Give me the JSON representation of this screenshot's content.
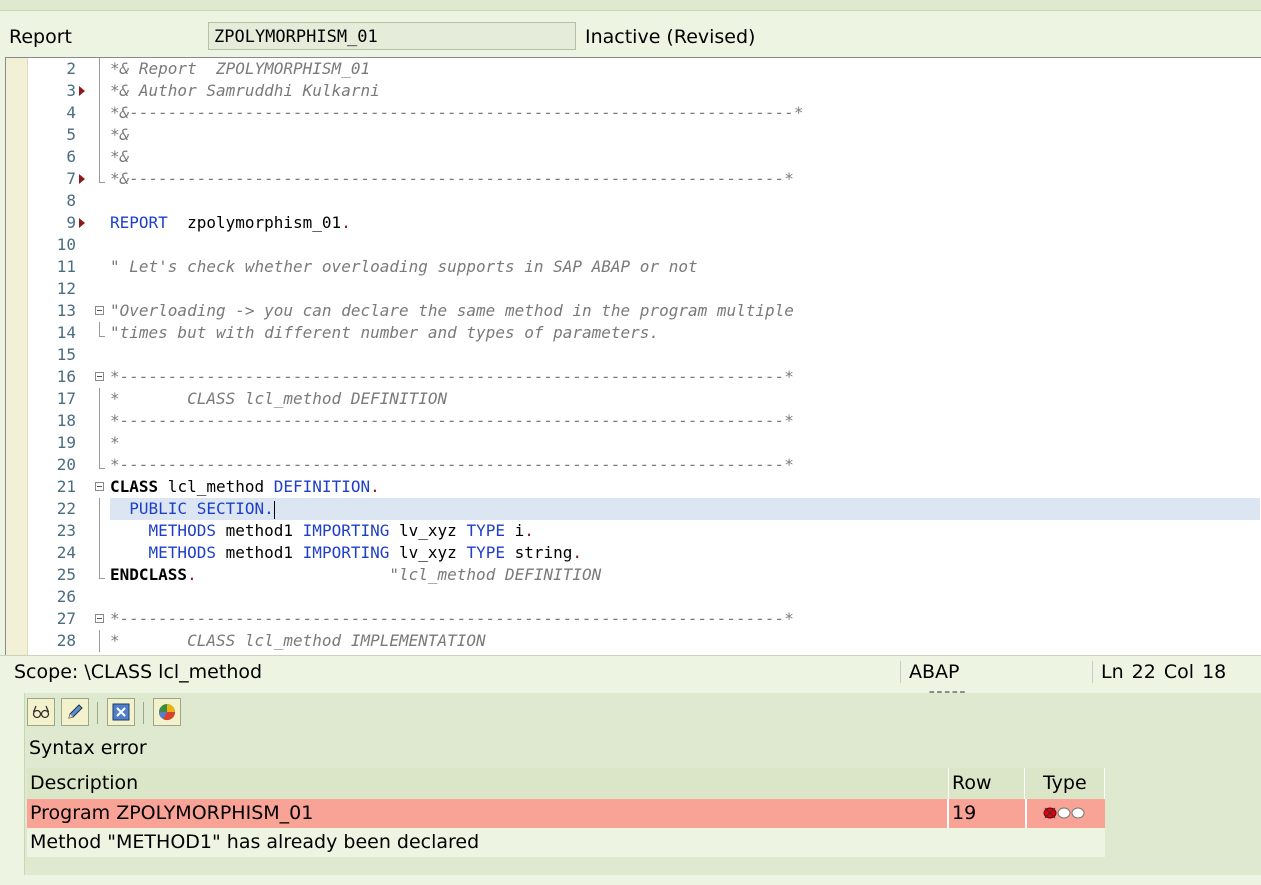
{
  "header": {
    "label": "Report",
    "program_name": "ZPOLYMORPHISM_01",
    "status": "Inactive (Revised)"
  },
  "editor": {
    "lines": [
      {
        "num": "2",
        "bp": false,
        "fold": "bar",
        "parts": [
          {
            "t": "*& Report  ZPOLYMORPHISM_01",
            "c": "cm"
          }
        ]
      },
      {
        "num": "3",
        "bp": true,
        "fold": "bar",
        "parts": [
          {
            "t": "*& Author Samruddhi Kulkarni",
            "c": "cm"
          }
        ]
      },
      {
        "num": "4",
        "bp": false,
        "fold": "bar",
        "parts": [
          {
            "t": "*&---------------------------------------------------------------------*",
            "c": "cm"
          }
        ]
      },
      {
        "num": "5",
        "bp": false,
        "fold": "bar",
        "parts": [
          {
            "t": "*&",
            "c": "cm"
          }
        ]
      },
      {
        "num": "6",
        "bp": false,
        "fold": "bar",
        "parts": [
          {
            "t": "*&",
            "c": "cm"
          }
        ]
      },
      {
        "num": "7",
        "bp": true,
        "fold": "end",
        "parts": [
          {
            "t": "*&--------------------------------------------------------------------*",
            "c": "cm"
          }
        ]
      },
      {
        "num": "8",
        "bp": false,
        "fold": "",
        "parts": []
      },
      {
        "num": "9",
        "bp": true,
        "fold": "",
        "parts": [
          {
            "t": "REPORT",
            "c": "kw"
          },
          {
            "t": "  zpolymorphism_01",
            "c": "tx"
          },
          {
            "t": ".",
            "c": "dot"
          }
        ]
      },
      {
        "num": "10",
        "bp": false,
        "fold": "",
        "parts": []
      },
      {
        "num": "11",
        "bp": false,
        "fold": "",
        "parts": [
          {
            "t": "\" Let's check whether overloading supports in SAP ABAP or not",
            "c": "cm"
          }
        ]
      },
      {
        "num": "12",
        "bp": false,
        "fold": "",
        "parts": []
      },
      {
        "num": "13",
        "bp": false,
        "fold": "box",
        "parts": [
          {
            "t": "\"Overloading -> you can declare the same method in the program multiple",
            "c": "cm"
          }
        ]
      },
      {
        "num": "14",
        "bp": false,
        "fold": "end",
        "parts": [
          {
            "t": "\"times but with different number and types of parameters.",
            "c": "cm"
          }
        ]
      },
      {
        "num": "15",
        "bp": false,
        "fold": "",
        "parts": []
      },
      {
        "num": "16",
        "bp": false,
        "fold": "box",
        "parts": [
          {
            "t": "*---------------------------------------------------------------------*",
            "c": "cm"
          }
        ]
      },
      {
        "num": "17",
        "bp": false,
        "fold": "bar",
        "parts": [
          {
            "t": "*       CLASS lcl_method DEFINITION",
            "c": "cm"
          }
        ]
      },
      {
        "num": "18",
        "bp": false,
        "fold": "bar",
        "parts": [
          {
            "t": "*---------------------------------------------------------------------*",
            "c": "cm"
          }
        ]
      },
      {
        "num": "19",
        "bp": false,
        "fold": "bar",
        "parts": [
          {
            "t": "*",
            "c": "cm"
          }
        ]
      },
      {
        "num": "20",
        "bp": false,
        "fold": "end",
        "parts": [
          {
            "t": "*---------------------------------------------------------------------*",
            "c": "cm"
          }
        ]
      },
      {
        "num": "21",
        "bp": false,
        "fold": "box",
        "parts": [
          {
            "t": "CLASS",
            "c": "bk"
          },
          {
            "t": " lcl_method ",
            "c": "tx"
          },
          {
            "t": "DEFINITION",
            "c": "kw"
          },
          {
            "t": ".",
            "c": "dot"
          }
        ]
      },
      {
        "num": "22",
        "bp": false,
        "fold": "bar",
        "cur": true,
        "parts": [
          {
            "t": "  PUBLIC SECTION.",
            "c": "kw"
          }
        ]
      },
      {
        "num": "23",
        "bp": false,
        "fold": "bar",
        "parts": [
          {
            "t": "    METHODS",
            "c": "kw"
          },
          {
            "t": " method1 ",
            "c": "tx"
          },
          {
            "t": "IMPORTING",
            "c": "kw"
          },
          {
            "t": " lv_xyz ",
            "c": "tx"
          },
          {
            "t": "TYPE",
            "c": "kw"
          },
          {
            "t": " i",
            "c": "tx"
          },
          {
            "t": ".",
            "c": "dot"
          }
        ]
      },
      {
        "num": "24",
        "bp": false,
        "fold": "bar",
        "parts": [
          {
            "t": "    METHODS",
            "c": "kw"
          },
          {
            "t": " method1 ",
            "c": "tx"
          },
          {
            "t": "IMPORTING",
            "c": "kw"
          },
          {
            "t": " lv_xyz ",
            "c": "tx"
          },
          {
            "t": "TYPE",
            "c": "kw"
          },
          {
            "t": " string",
            "c": "tx"
          },
          {
            "t": ".",
            "c": "dot"
          }
        ]
      },
      {
        "num": "25",
        "bp": false,
        "fold": "end",
        "parts": [
          {
            "t": "ENDCLASS",
            "c": "bk"
          },
          {
            "t": ".",
            "c": "dot"
          },
          {
            "t": "                    \"lcl_method DEFINITION",
            "c": "cm"
          }
        ]
      },
      {
        "num": "26",
        "bp": false,
        "fold": "",
        "parts": []
      },
      {
        "num": "27",
        "bp": false,
        "fold": "box",
        "parts": [
          {
            "t": "*---------------------------------------------------------------------*",
            "c": "cm"
          }
        ]
      },
      {
        "num": "28",
        "bp": false,
        "fold": "bar",
        "parts": [
          {
            "t": "*       CLASS lcl_method IMPLEMENTATION",
            "c": "cm"
          }
        ]
      }
    ]
  },
  "statusbar": {
    "scope": "Scope: \\CLASS lcl_method",
    "language": "ABAP",
    "position": "Ln  22 Col  18"
  },
  "errors": {
    "toolbar_icons": [
      "glasses-icon",
      "pencil-icon",
      "close-box-icon",
      "pie-chart-icon"
    ],
    "title": "Syntax error",
    "columns": {
      "description": "Description",
      "row": "Row",
      "type": "Type"
    },
    "program_row": {
      "description": "Program ZPOLYMORPHISM_01",
      "row": "19",
      "type_icon": "error-status-icon"
    },
    "message": "Method \"METHOD1\" has already been declared",
    "colors": {
      "error_row": "#f8a396",
      "error_light": "#e8000f"
    }
  }
}
